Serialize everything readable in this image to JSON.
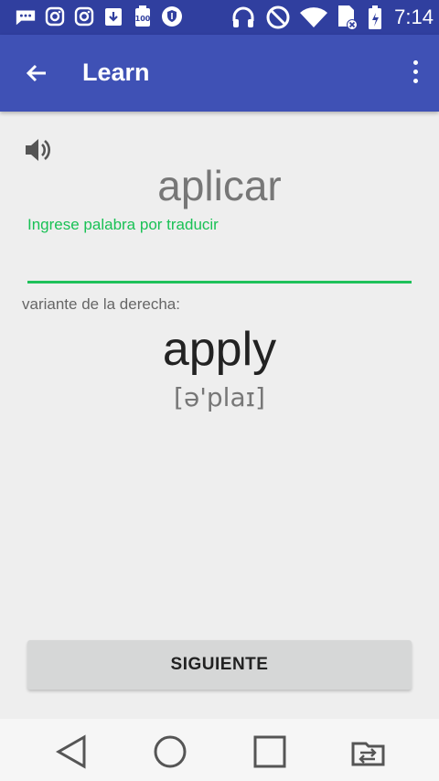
{
  "status_bar": {
    "time": "7:14",
    "icons": [
      "messages-icon",
      "instagram-icon",
      "instagram-icon",
      "download-icon",
      "battery-saver-icon",
      "shield-icon",
      "headphones-icon",
      "do-not-disturb-icon",
      "wifi-icon",
      "sim-icon",
      "battery-icon"
    ]
  },
  "app_bar": {
    "title": "Learn",
    "back_icon": "arrow-back-icon",
    "menu_icon": "more-vert-icon",
    "color": "#3f51b5",
    "status_color": "#303f9f"
  },
  "card": {
    "speaker_icon": "volume-icon",
    "word": "aplicar",
    "input_hint": "Ingrese palabra por traducir",
    "input_value": "",
    "variant_label": "variante de la derecha:",
    "answer": "apply",
    "transcription": "[ə'plaɪ]",
    "accent": "#1ec15a"
  },
  "actions": {
    "next_label": "SIGUIENTE"
  },
  "nav_bar": {
    "buttons": [
      "back-triangle-icon",
      "home-circle-icon",
      "recents-square-icon",
      "switch-app-icon"
    ]
  }
}
